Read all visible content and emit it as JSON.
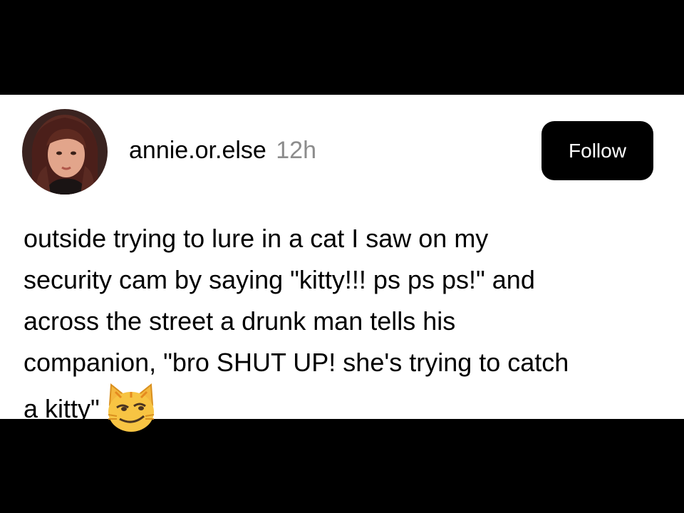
{
  "post": {
    "author": {
      "username": "annie.or.else",
      "avatar_icon": "profile-photo"
    },
    "timestamp": "12h",
    "follow_label": "Follow",
    "text_lines": [
      "outside trying to lure in a cat I saw on my",
      "security cam by saying \"kitty!!! ps ps ps!\" and",
      "across the street a drunk man tells his",
      "companion, \"bro SHUT UP! she's trying to catch",
      "a kitty\""
    ],
    "trailing_emoji": "smirking-cat-face-icon"
  },
  "colors": {
    "background": "#000000",
    "card": "#ffffff",
    "text": "#000000",
    "muted": "#8c8c8c",
    "button": "#000000",
    "button_text": "#ffffff"
  }
}
